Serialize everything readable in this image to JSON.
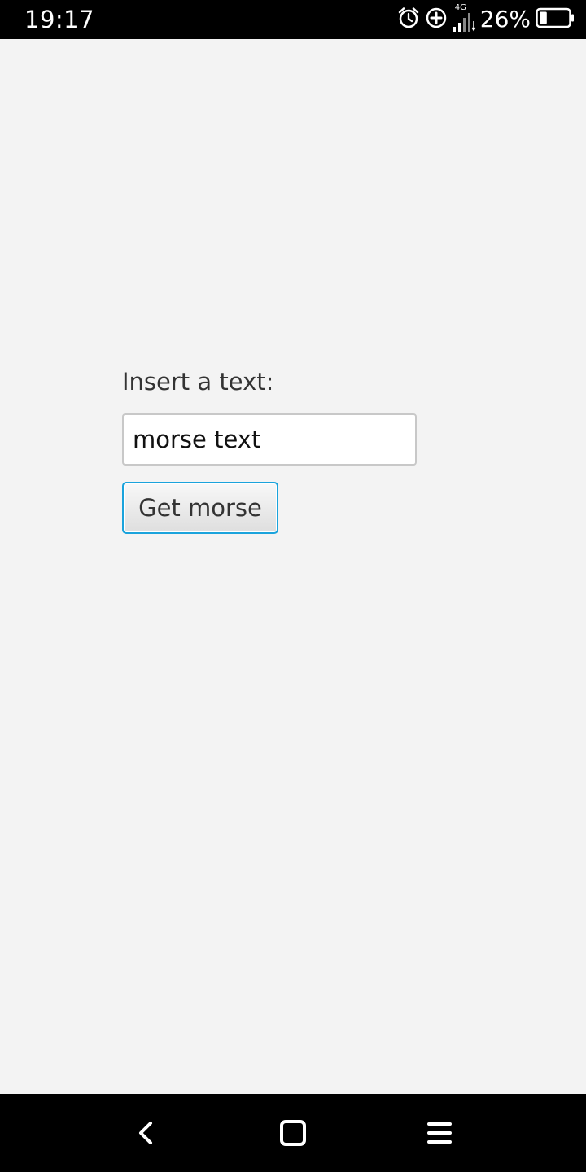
{
  "status_bar": {
    "time": "19:17",
    "network_type": "4G",
    "battery_percent": "26%",
    "battery_level": 0.26,
    "icons": [
      "alarm-icon",
      "data-saver-icon",
      "signal-icon",
      "battery-icon"
    ]
  },
  "form": {
    "label": "Insert a text:",
    "input_value": "morse text",
    "button_label": "Get morse"
  },
  "nav_bar": {
    "icons": [
      "back-icon",
      "home-icon",
      "menu-icon"
    ]
  },
  "colors": {
    "background": "#f3f3f3",
    "button_focus_border": "#1aa3dc"
  }
}
